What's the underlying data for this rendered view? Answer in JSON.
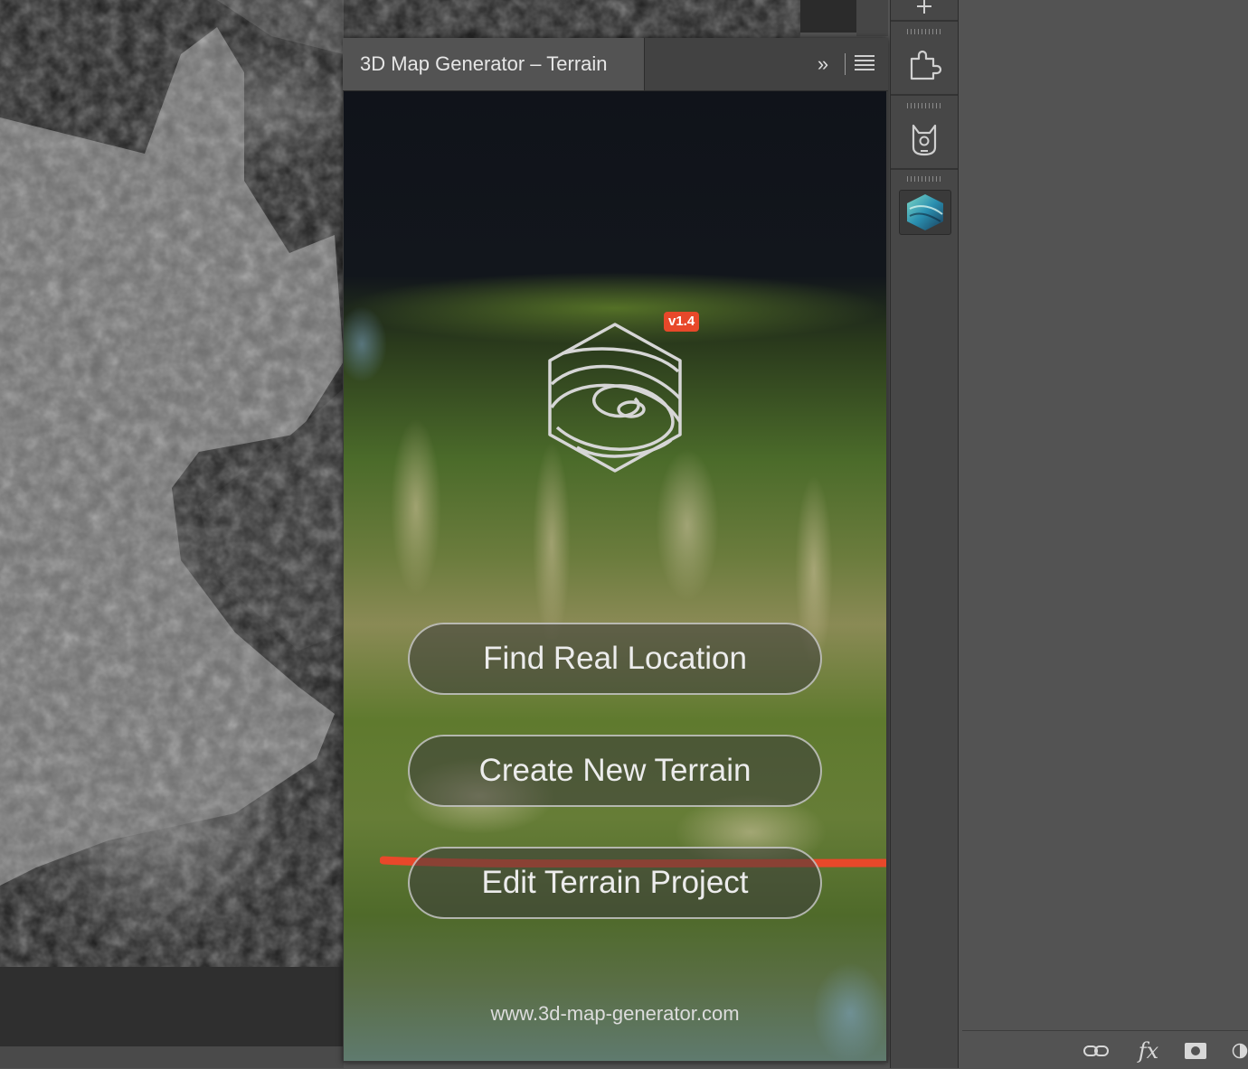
{
  "panel": {
    "title": "3D Map Generator – Terrain",
    "collapse_glyph": "»",
    "menu_icon": "hamburger-menu-icon"
  },
  "hero": {
    "version_badge": "v1.4",
    "logo_icon": "topographic-hexagon-logo"
  },
  "actions": {
    "find_real_location": "Find Real Location",
    "create_new_terrain": "Create New Terrain",
    "edit_terrain_project": "Edit Terrain Project"
  },
  "footer": {
    "website": "www.3d-map-generator.com"
  },
  "dock": {
    "icons": [
      "plugins-icon",
      "cat-icon",
      "3d-map-generator-app-icon"
    ]
  },
  "bottom_toolbar": {
    "icons": [
      "link-icon",
      "fx-icon",
      "mask-icon",
      "adjustment-icon"
    ],
    "fx_label": "fx"
  },
  "colors": {
    "annotation": "#e8482a",
    "badge": "#e8482a",
    "panel_tab": "#535353"
  }
}
